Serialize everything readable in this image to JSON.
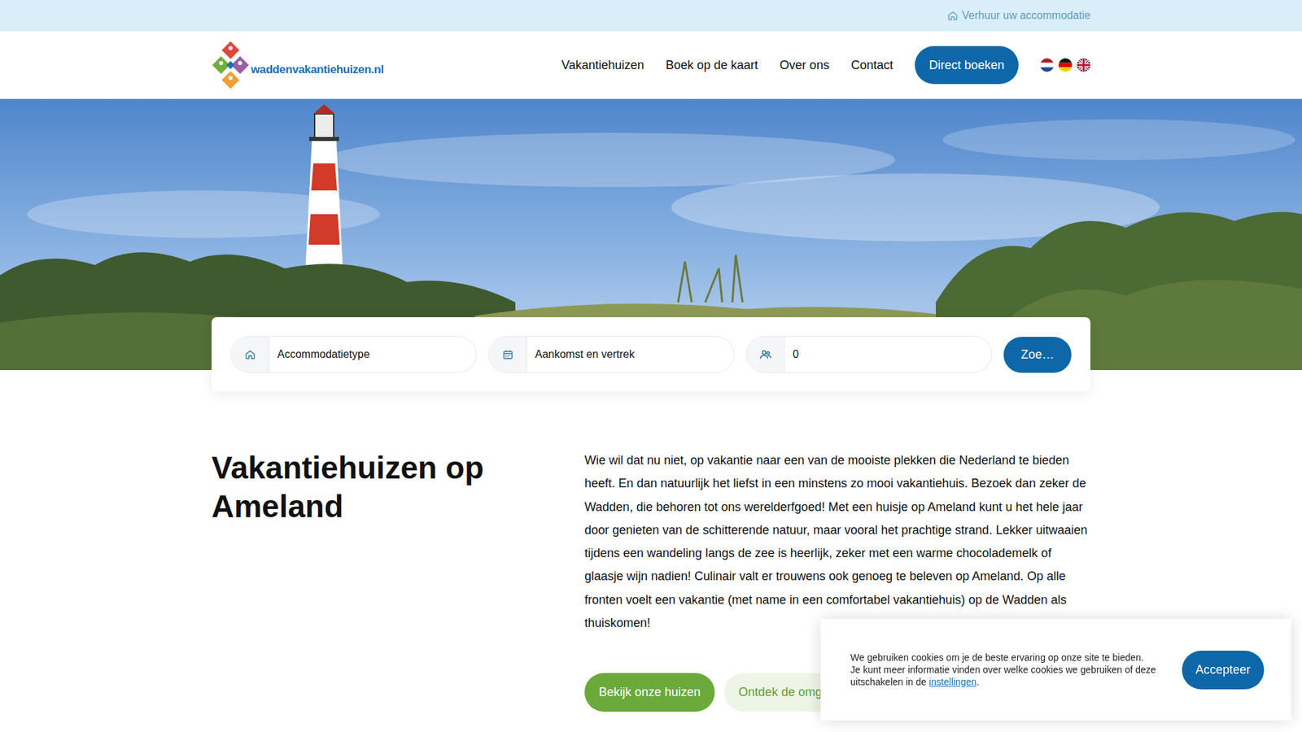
{
  "topbar": {
    "link": "Verhuur uw accommodatie"
  },
  "logo": {
    "text": "waddenvakantiehuizen.nl"
  },
  "nav": {
    "items": [
      {
        "label": "Vakantiehuizen"
      },
      {
        "label": "Boek op de kaart"
      },
      {
        "label": "Over ons"
      },
      {
        "label": "Contact"
      }
    ],
    "cta": "Direct boeken",
    "languages": [
      {
        "kind": "nl"
      },
      {
        "kind": "de"
      },
      {
        "kind": "en"
      }
    ]
  },
  "search": {
    "fields": [
      {
        "kind": "type",
        "value": "Accommodatietype"
      },
      {
        "kind": "dates",
        "value": "Aankomst en vertrek"
      },
      {
        "kind": "guests",
        "value": "0"
      }
    ],
    "button": "Zoe…"
  },
  "intro": {
    "title": "Vakantiehuizen op Ameland",
    "text": "Wie wil dat nu niet, op vakantie naar een van de mooiste plekken die Nederland te bieden heeft. En dan natuurlijk het liefst in een minstens zo mooi vakantiehuis. Bezoek dan zeker de Wadden, die behoren tot ons werelderfgoed! Met een huisje op Ameland kunt u het hele jaar door genieten van de schitterende natuur, maar vooral het prachtige strand. Lekker uitwaaien tijdens een wandeling langs de zee is heerlijk, zeker met een warme chocolademelk of glaasje wijn nadien! Culinair valt er trouwens ook genoeg te beleven op Ameland. Op alle fronten voelt een vakantie (met name in een comfortabel vakantiehuis) op de Wadden als thuiskomen!",
    "buttons": [
      {
        "label": "Bekijk onze huizen",
        "kind": "primary"
      },
      {
        "label": "Ontdek de omg",
        "kind": "secondary"
      }
    ]
  },
  "cookie": {
    "lines": [
      "We gebruiken cookies om je de beste ervaring op onze site te bieden.",
      "Je kunt meer informatie vinden over welke cookies we gebruiken of deze"
    ],
    "lastBefore": "uitschakelen in de ",
    "link": "instellingen",
    "lastAfter": ".",
    "button": "Accepteer"
  }
}
